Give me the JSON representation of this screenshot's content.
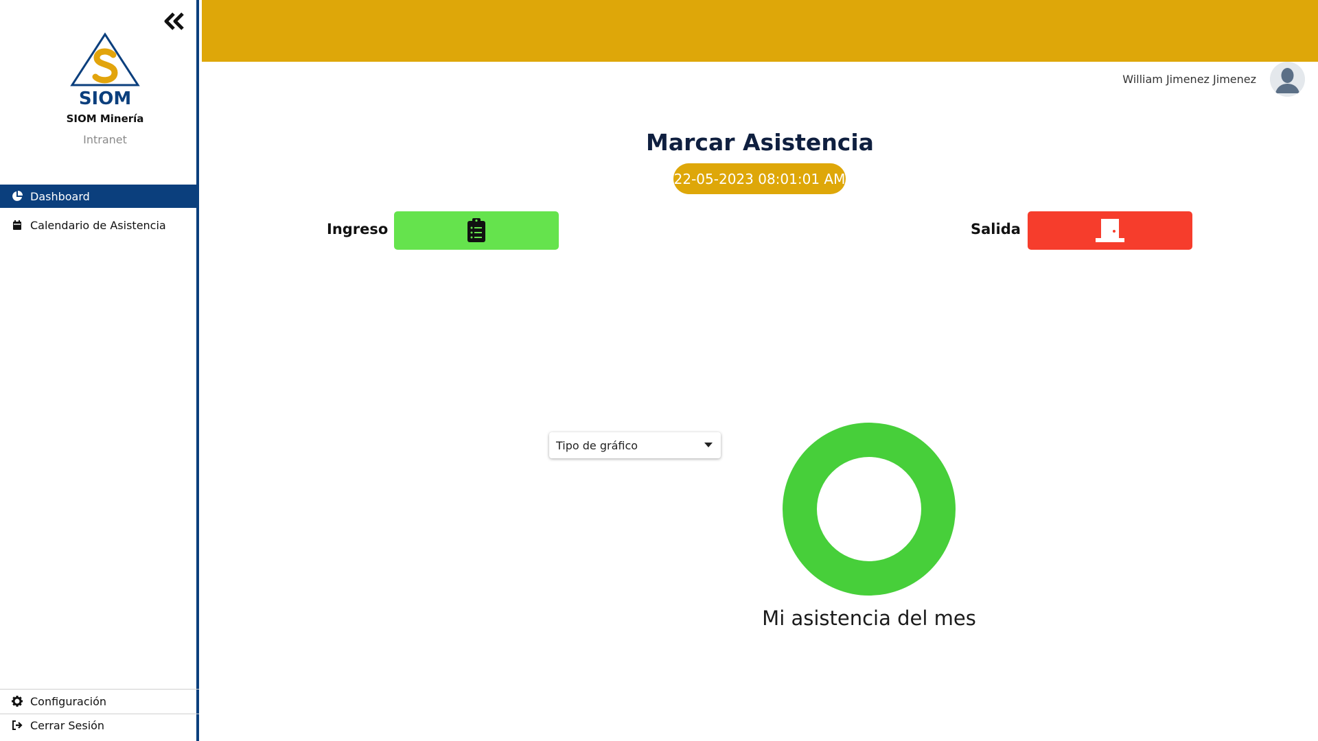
{
  "sidebar": {
    "brand": {
      "logo_text": "SIOM",
      "name": "SIOM Minería",
      "subtitle": "Intranet"
    },
    "items": [
      {
        "label": "Dashboard",
        "icon": "pie-chart-icon",
        "active": true
      },
      {
        "label": "Calendario de Asistencia",
        "icon": "calendar-icon",
        "active": false
      }
    ],
    "bottom_items": [
      {
        "label": "Configuración",
        "icon": "gear-icon"
      },
      {
        "label": "Cerrar Sesión",
        "icon": "sign-out-icon"
      }
    ],
    "collapse_icon": "double-chevron-left-icon"
  },
  "header": {
    "user_name": "William Jimenez Jimenez",
    "colors": {
      "topbar": "#dea709",
      "sidebar_accent": "#0b3f7d"
    }
  },
  "main": {
    "title": "Marcar Asistencia",
    "datetime": "22-05-2023 08:01:01 AM",
    "ingreso_label": "Ingreso",
    "salida_label": "Salida",
    "ingreso_icon": "clipboard-list-icon",
    "salida_icon": "door-icon",
    "colors": {
      "ingreso": "#65e34d",
      "salida": "#f63d2c"
    },
    "chart_select": {
      "placeholder": "Tipo de gráfico"
    },
    "chart_title": "Mi asistencia del mes"
  },
  "chart_data": {
    "type": "pie",
    "title": "Mi asistencia del mes",
    "categories": [
      ""
    ],
    "values": [
      1
    ],
    "colors": [
      "#47cf3a"
    ]
  }
}
